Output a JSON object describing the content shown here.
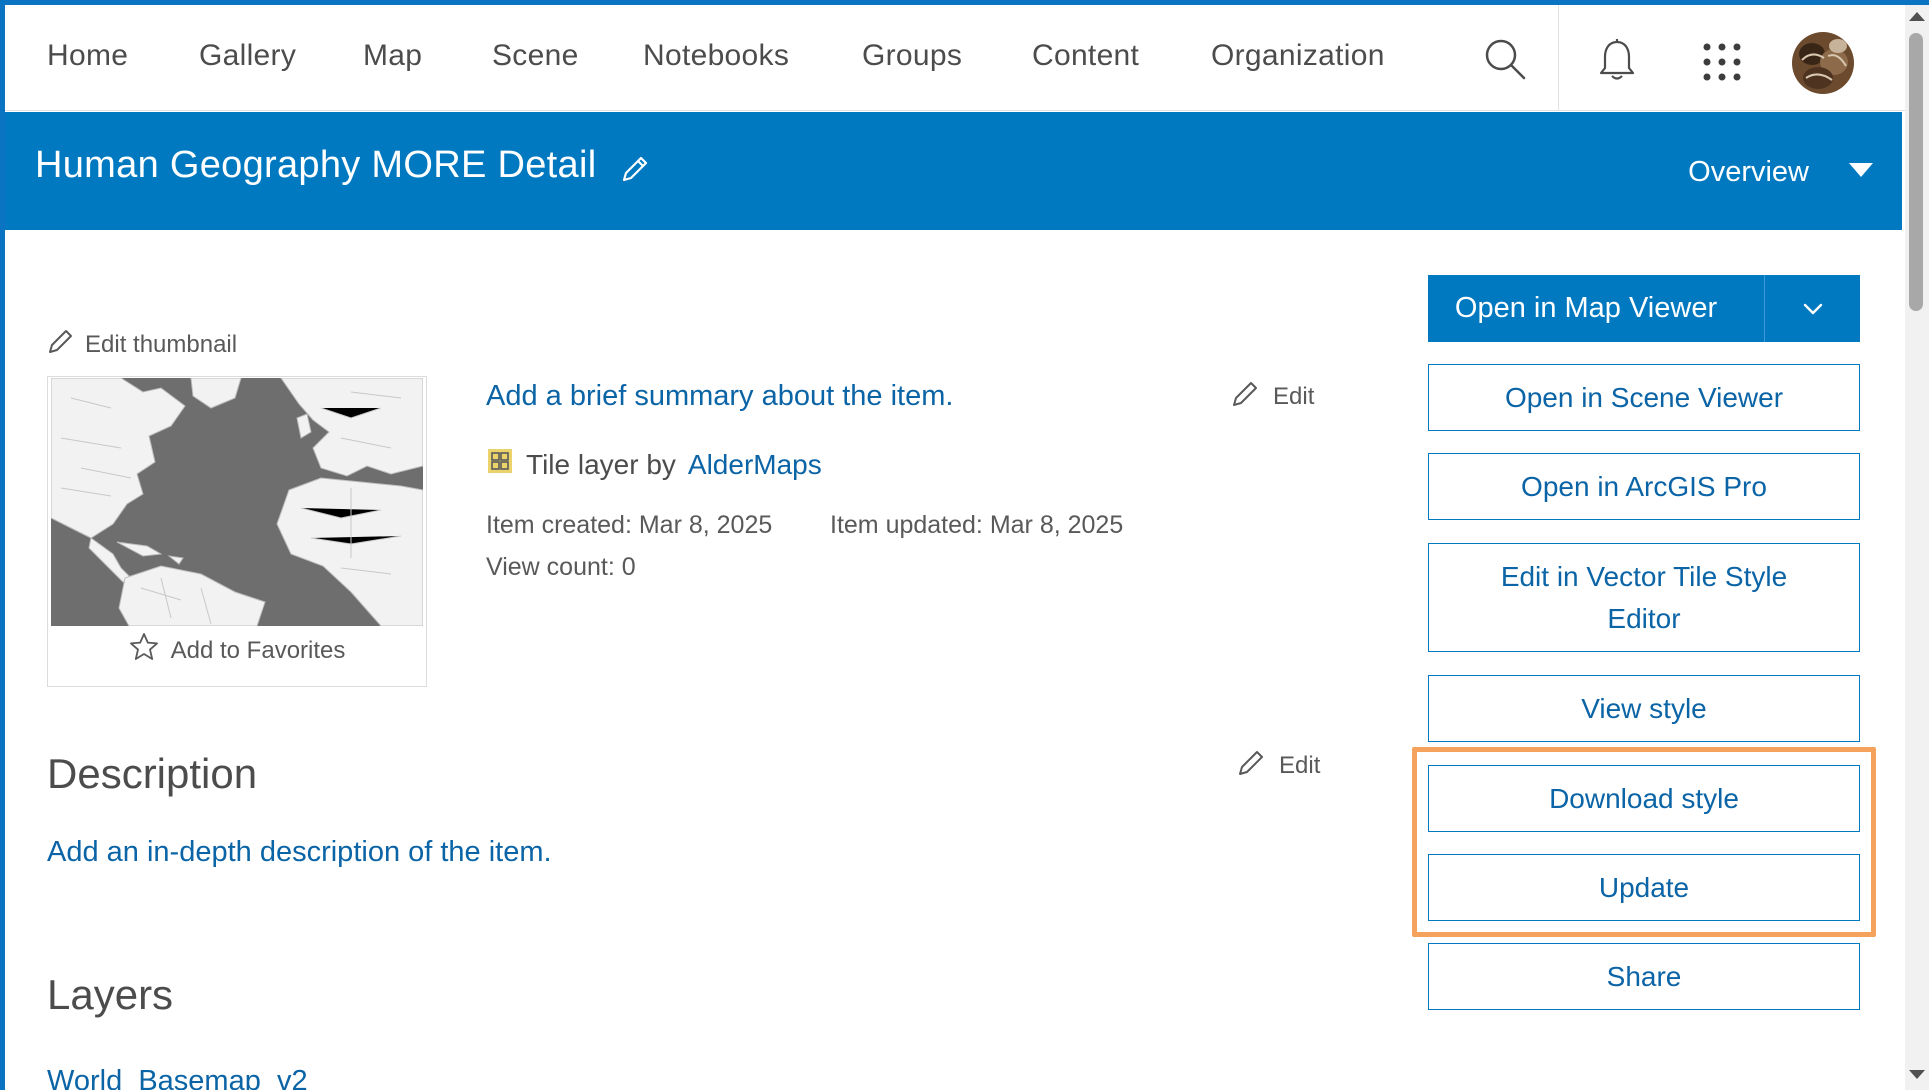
{
  "nav": {
    "items": [
      "Home",
      "Gallery",
      "Map",
      "Scene",
      "Notebooks",
      "Groups",
      "Content",
      "Organization"
    ],
    "icons": [
      "search-icon",
      "bell-icon",
      "app-launcher-icon",
      "user-avatar"
    ]
  },
  "header": {
    "title": "Human Geography MORE Detail",
    "view_selector": "Overview",
    "band_color": "#0079c1"
  },
  "thumbnail": {
    "edit_label": "Edit thumbnail",
    "favorites_label": "Add to Favorites"
  },
  "summary": {
    "text": "Add a brief summary about the item.",
    "edit_label": "Edit"
  },
  "item": {
    "type_prefix": "Tile layer by",
    "owner": "AlderMaps",
    "created": "Item created: Mar 8, 2025",
    "updated": "Item updated: Mar 8, 2025",
    "views": "View count: 0"
  },
  "description": {
    "heading": "Description",
    "edit_label": "Edit",
    "placeholder": "Add an in-depth description of the item."
  },
  "layers": {
    "heading": "Layers",
    "first": "World_Basemap_v2"
  },
  "actions": {
    "open_map_viewer": "Open in Map Viewer",
    "open_scene_viewer": "Open in Scene Viewer",
    "open_arcgis_pro": "Open in ArcGIS Pro",
    "edit_vector_style": "Edit in Vector Tile Style Editor",
    "view_style": "View style",
    "download_style": "Download style",
    "update": "Update",
    "share": "Share",
    "highlight_color": "#f5a25d"
  }
}
